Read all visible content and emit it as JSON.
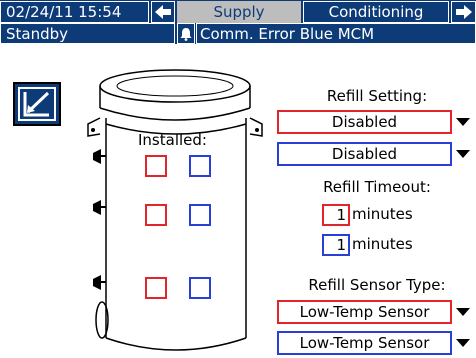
{
  "header": {
    "datetime": "02/24/11 15:54",
    "tabs": [
      {
        "label": "Supply",
        "active": true
      },
      {
        "label": "Conditioning",
        "active": false
      }
    ],
    "status": "Standby",
    "error_message": "Comm. Error Blue MCM"
  },
  "tank": {
    "installed_label": "Installed:"
  },
  "refill_setting": {
    "title": "Refill Setting:",
    "red_value": "Disabled",
    "blue_value": "Disabled"
  },
  "refill_timeout": {
    "title": "Refill Timeout:",
    "red_value": "1",
    "blue_value": "1",
    "unit": "minutes"
  },
  "refill_sensor": {
    "title": "Refill Sensor Type:",
    "red_value": "Low-Temp Sensor",
    "blue_value": "Low-Temp Sensor"
  },
  "colors": {
    "header_bg": "#0d3b78",
    "active_tab": "#bdbdbd",
    "red": "#e0262b",
    "blue": "#2a3fd6"
  },
  "icons": [
    "left-arrow-icon",
    "right-arrow-icon",
    "alarm-bell-icon",
    "edit-icon",
    "dropdown-arrow-icon"
  ]
}
